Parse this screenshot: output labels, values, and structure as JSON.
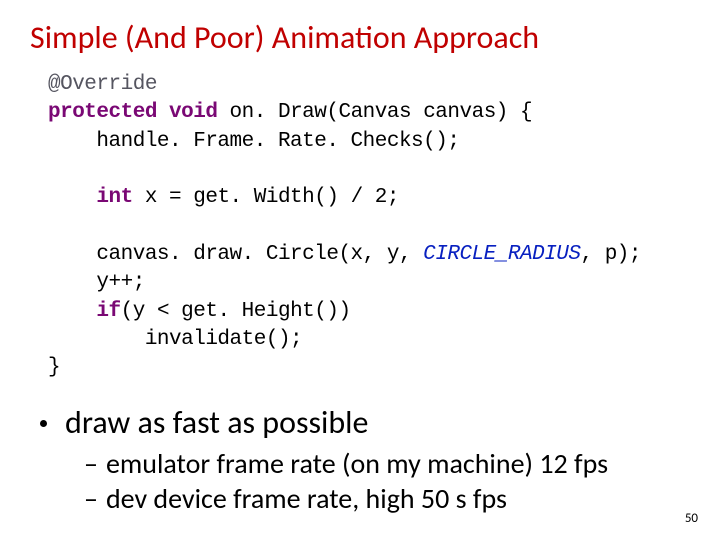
{
  "title": "Simple (And Poor) Animation Approach",
  "code": {
    "anno": "@Override",
    "kw_protected": "protected",
    "kw_void": "void",
    "sig": " on. Draw(Canvas canvas) {",
    "line2": "    handle. Frame. Rate. Checks();",
    "blank1": "",
    "kw_int": "int",
    "line3_rest": " x = get. Width() / 2;",
    "blank2": "",
    "line5a": "    canvas. draw. Circle(x, y, ",
    "const": "CIRCLE_RADIUS",
    "line5b": ", p);",
    "line6": "    y++;",
    "kw_if": "if",
    "line7_rest": "(y < get. Height())",
    "line8": "        invalidate();",
    "line9": "}"
  },
  "bullet": "draw as fast as possible",
  "sub1": "emulator frame rate (on my machine) 12 fps",
  "sub2": "dev device frame rate, high 50 s fps",
  "dash": "–",
  "page": "50"
}
